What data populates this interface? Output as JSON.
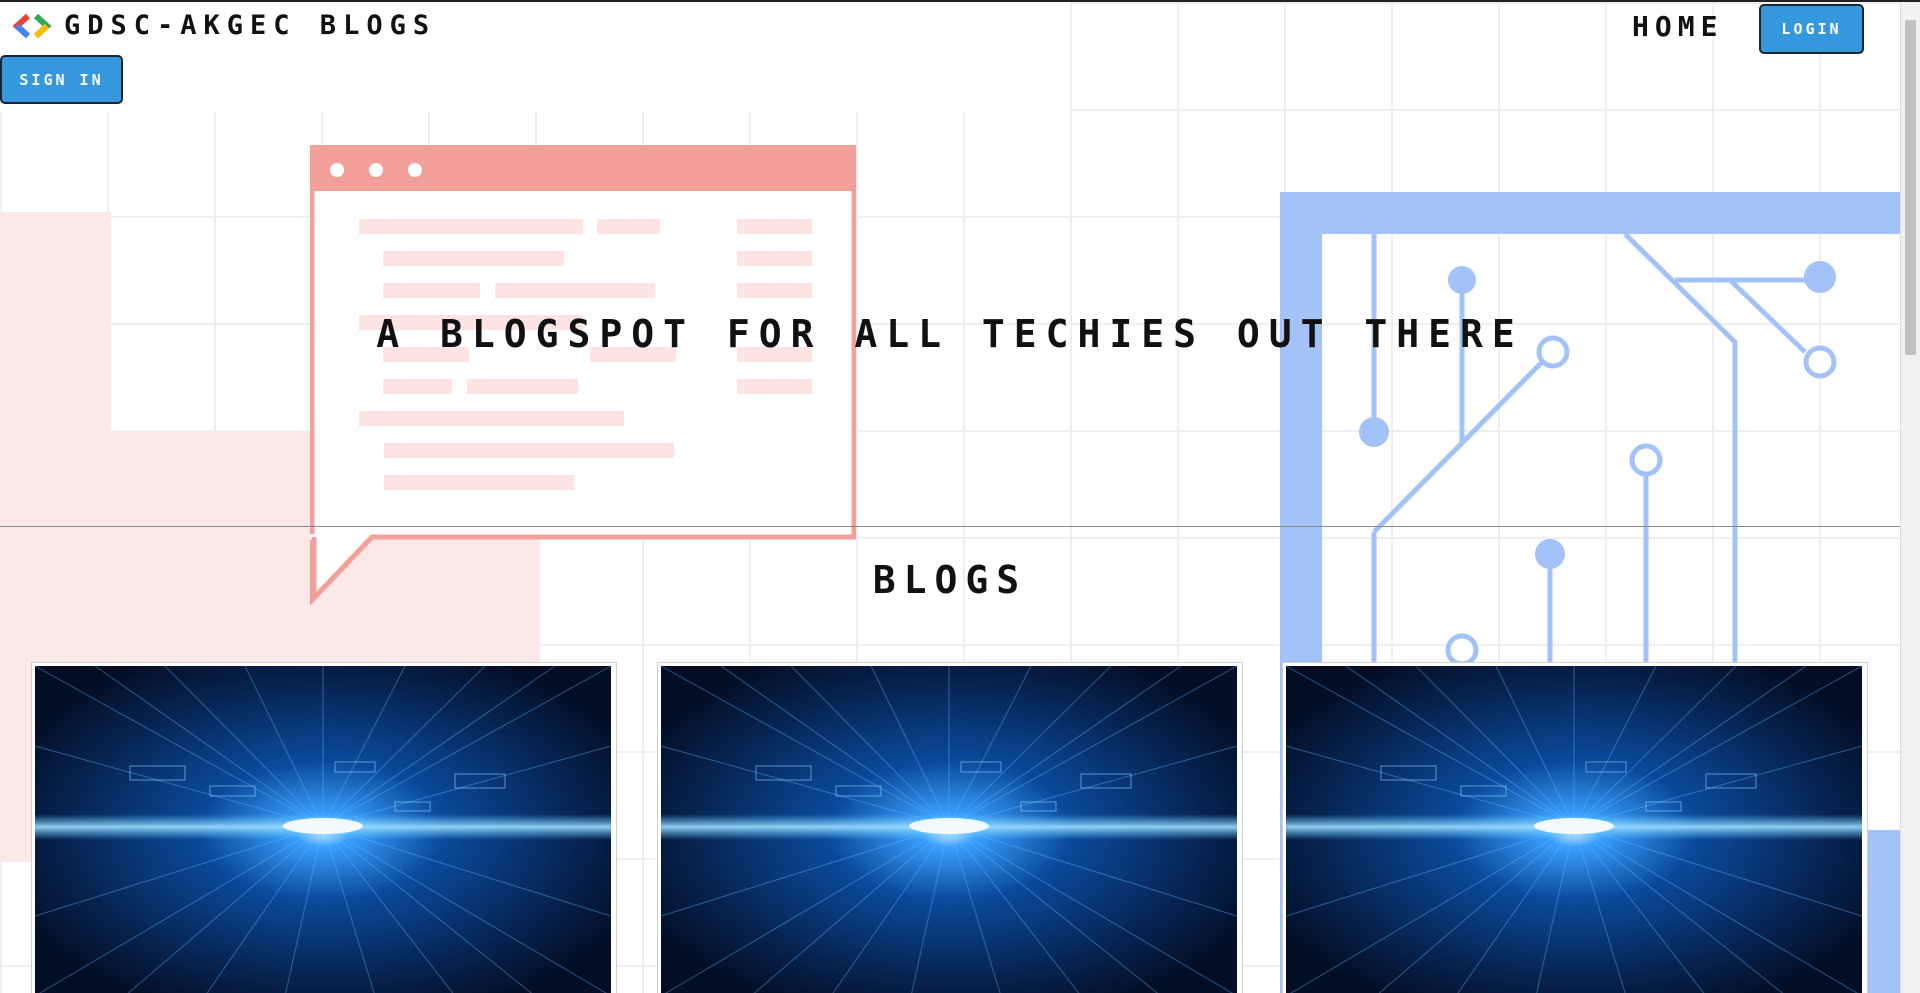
{
  "header": {
    "brand_title": "GDSC-AKGEC BLOGS",
    "logo_icon": "gdsc-brackets-logo-icon",
    "nav_home": "HOME",
    "login_label": "LOGIN",
    "signin_label": "SIGN IN"
  },
  "hero": {
    "tagline": "A BLOGSPOT FOR ALL TECHIES OUT THERE",
    "browser_illustration_icon": "browser-window-illustration",
    "circuit_illustration_icon": "circuit-board-illustration"
  },
  "blogs": {
    "heading": "BLOGS",
    "cards": [
      {
        "image_icon": "tech-data-tunnel-image"
      },
      {
        "image_icon": "tech-data-tunnel-image"
      },
      {
        "image_icon": "tech-data-tunnel-image"
      }
    ]
  },
  "colors": {
    "button_blue": "#3598dc",
    "illustration_pink": "#f4a09a",
    "illustration_blue": "#a3c2f7",
    "pink_block": "#fde8e8",
    "logo_red": "#ea4335",
    "logo_blue": "#4285f4",
    "logo_green": "#34a853",
    "logo_yellow": "#fbbc05"
  }
}
